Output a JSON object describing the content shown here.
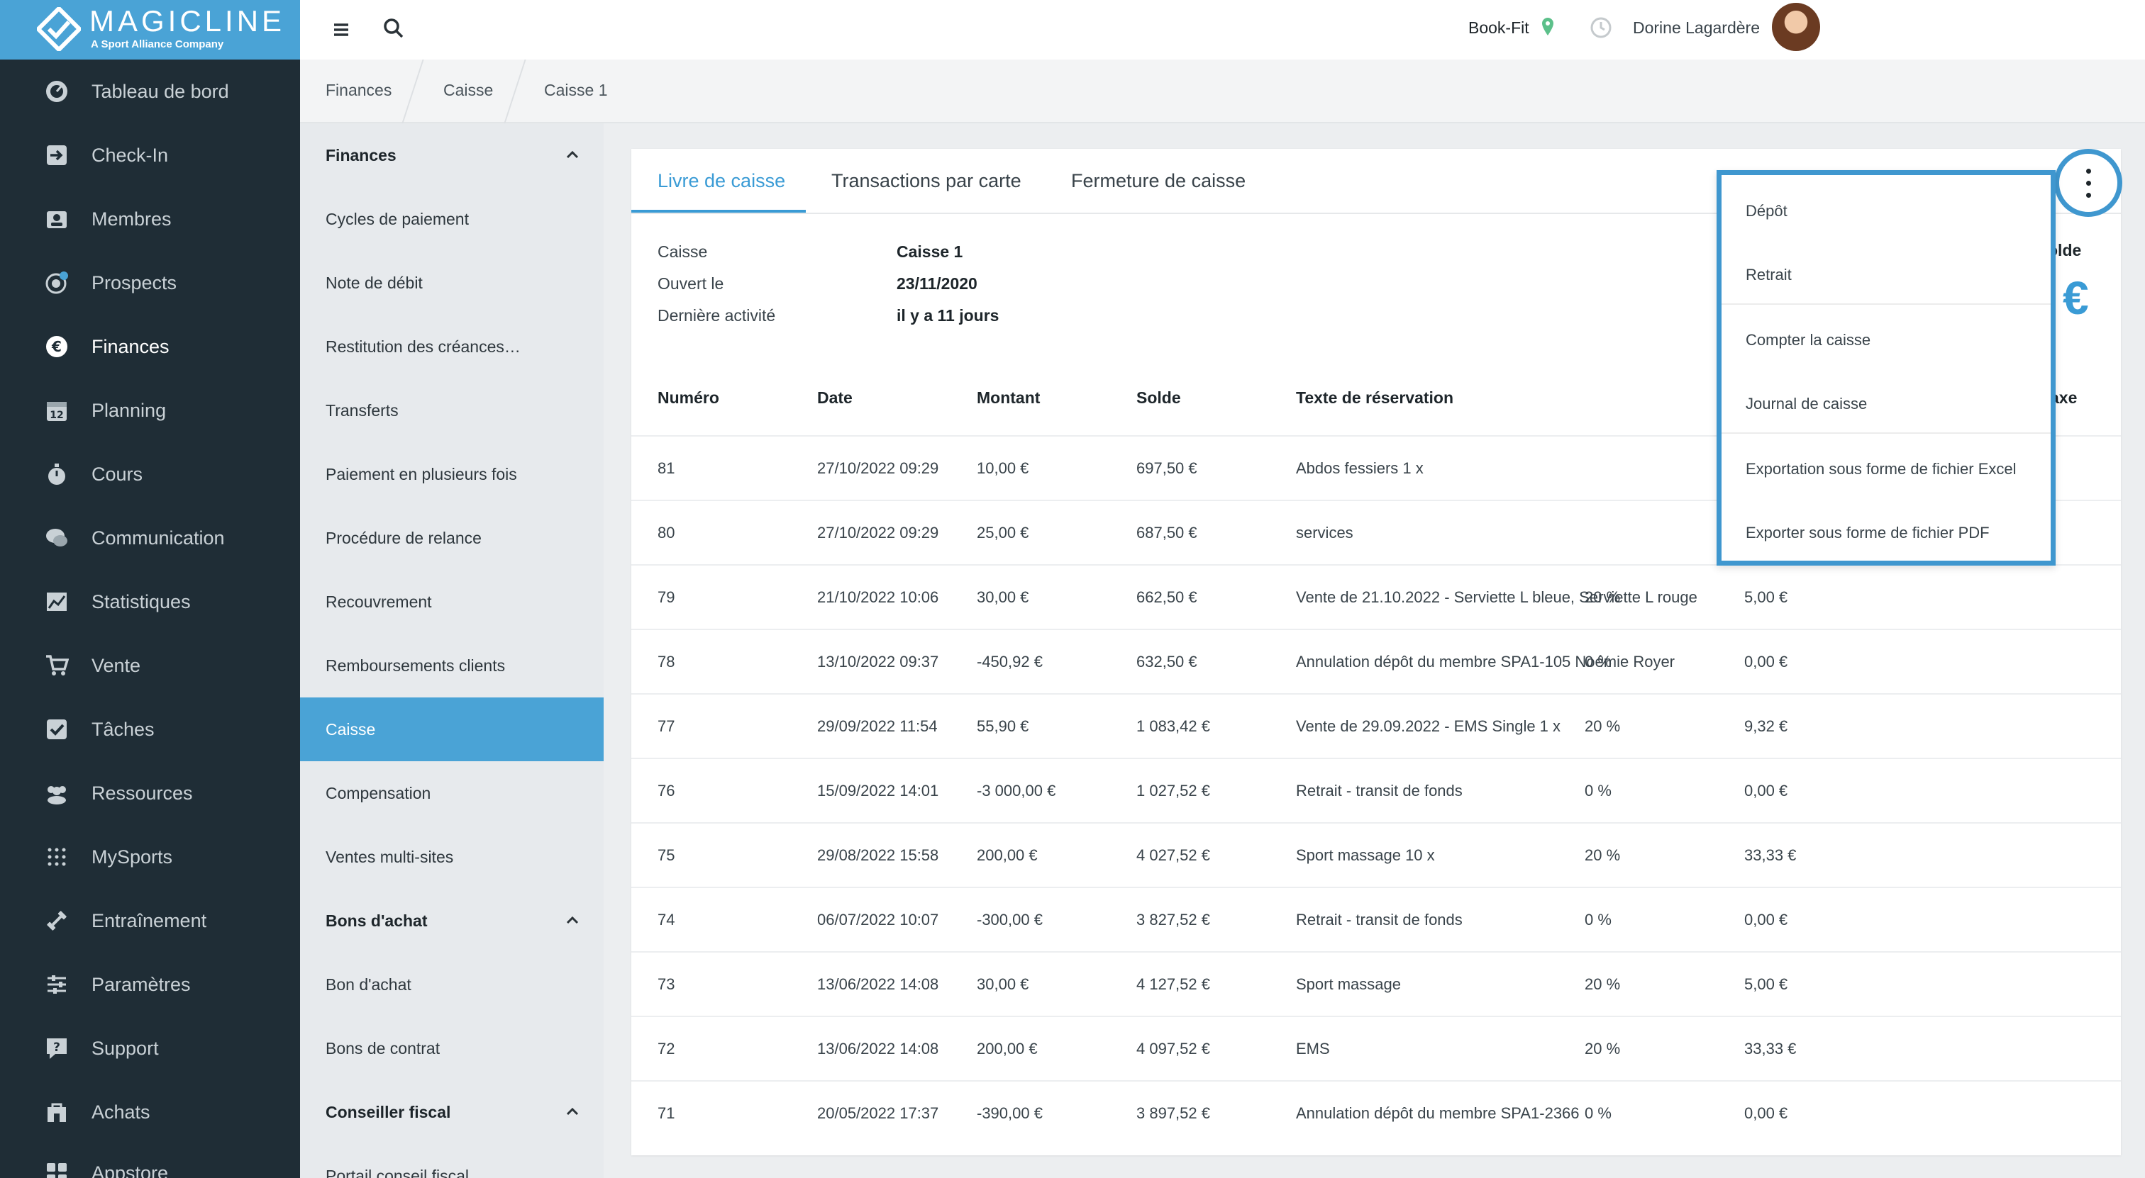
{
  "brand": {
    "name": "MAGICLINE",
    "tagline": "A Sport Alliance Company"
  },
  "sidebar": {
    "items": [
      {
        "label": "Tableau de bord",
        "icon": "dashboard-icon"
      },
      {
        "label": "Check-In",
        "icon": "checkin-icon"
      },
      {
        "label": "Membres",
        "icon": "members-icon"
      },
      {
        "label": "Prospects",
        "icon": "prospects-icon"
      },
      {
        "label": "Finances",
        "icon": "euro-icon",
        "active": true
      },
      {
        "label": "Planning",
        "icon": "calendar-icon"
      },
      {
        "label": "Cours",
        "icon": "stopwatch-icon"
      },
      {
        "label": "Communication",
        "icon": "chat-icon"
      },
      {
        "label": "Statistiques",
        "icon": "chart-icon"
      },
      {
        "label": "Vente",
        "icon": "cart-icon"
      },
      {
        "label": "Tâches",
        "icon": "checkbox-icon"
      },
      {
        "label": "Ressources",
        "icon": "group-icon"
      },
      {
        "label": "MySports",
        "icon": "grid-dots-icon"
      },
      {
        "label": "Entraînement",
        "icon": "dumbbell-icon"
      },
      {
        "label": "Paramètres",
        "icon": "sliders-icon"
      },
      {
        "label": "Support",
        "icon": "help-icon"
      },
      {
        "label": "Achats",
        "icon": "shop-icon"
      },
      {
        "label": "Appstore",
        "icon": "apps-icon"
      }
    ]
  },
  "header": {
    "club": "Book-Fit",
    "user": "Dorine Lagardère"
  },
  "breadcrumb": [
    "Finances",
    "Caisse",
    "Caisse 1"
  ],
  "submenu": {
    "items": [
      {
        "label": "Finances",
        "header": true
      },
      {
        "label": "Cycles de paiement"
      },
      {
        "label": "Note de débit"
      },
      {
        "label": "Restitution des créances…"
      },
      {
        "label": "Transferts"
      },
      {
        "label": "Paiement en plusieurs fois"
      },
      {
        "label": "Procédure de relance"
      },
      {
        "label": "Recouvrement"
      },
      {
        "label": "Remboursements clients"
      },
      {
        "label": "Caisse",
        "selected": true
      },
      {
        "label": "Compensation"
      },
      {
        "label": "Ventes multi-sites"
      },
      {
        "label": "Bons d'achat",
        "header": true
      },
      {
        "label": "Bon d'achat"
      },
      {
        "label": "Bons de contrat"
      },
      {
        "label": "Conseiller fiscal",
        "header": true
      },
      {
        "label": "Portail conseil fiscal"
      }
    ]
  },
  "tabs": [
    "Livre de caisse",
    "Transactions par carte",
    "Fermeture de caisse"
  ],
  "info": {
    "caisse_label": "Caisse",
    "caisse_value": "Caisse 1",
    "opened_label": "Ouvert le",
    "opened_value": "23/11/2020",
    "activity_label": "Dernière activité",
    "activity_value": "il y a 11 jours",
    "solde_fragment": "olde",
    "euro_symbol": "€"
  },
  "table": {
    "headers": [
      "Numéro",
      "Date",
      "Montant",
      "Solde",
      "Texte de réservation"
    ],
    "taxe_fragment": "axe",
    "rows": [
      [
        "81",
        "27/10/2022 09:29",
        "10,00 €",
        "697,50 €",
        "Abdos fessiers 1 x",
        "",
        ""
      ],
      [
        "80",
        "27/10/2022 09:29",
        "25,00 €",
        "687,50 €",
        "services",
        "",
        ""
      ],
      [
        "79",
        "21/10/2022 10:06",
        "30,00 €",
        "662,50 €",
        "Vente de 21.10.2022 - Serviette L bleue, Serviette L rouge",
        "20 %",
        "5,00 €"
      ],
      [
        "78",
        "13/10/2022 09:37",
        "-450,92 €",
        "632,50 €",
        "Annulation dépôt du membre SPA1-105 Noémie Royer",
        "0 %",
        "0,00 €"
      ],
      [
        "77",
        "29/09/2022 11:54",
        "55,90 €",
        "1 083,42 €",
        "Vente de 29.09.2022 - EMS Single 1 x",
        "20 %",
        "9,32 €"
      ],
      [
        "76",
        "15/09/2022 14:01",
        "-3 000,00 €",
        "1 027,52 €",
        "Retrait - transit de fonds",
        "0 %",
        "0,00 €"
      ],
      [
        "75",
        "29/08/2022 15:58",
        "200,00 €",
        "4 027,52 €",
        "Sport massage 10 x",
        "20 %",
        "33,33 €"
      ],
      [
        "74",
        "06/07/2022 10:07",
        "-300,00 €",
        "3 827,52 €",
        "Retrait - transit de fonds",
        "0 %",
        "0,00 €"
      ],
      [
        "73",
        "13/06/2022 14:08",
        "30,00 €",
        "4 127,52 €",
        "Sport massage",
        "20 %",
        "5,00 €"
      ],
      [
        "72",
        "13/06/2022 14:08",
        "200,00 €",
        "4 097,52 €",
        "EMS",
        "20 %",
        "33,33 €"
      ],
      [
        "71",
        "20/05/2022 17:37",
        "-390,00 €",
        "3 897,52 €",
        "Annulation dépôt du membre SPA1-2366",
        "0 %",
        "0,00 €"
      ]
    ]
  },
  "dropdown": {
    "items": [
      "Dépôt",
      "Retrait",
      "Compter la caisse",
      "Journal de caisse",
      "Exportation sous forme de fichier Excel",
      "Exporter sous forme de fichier PDF"
    ]
  },
  "colors": {
    "accent": "#3a9bd5",
    "sidebar_bg": "#1f2d36",
    "logo_bg": "#4aa3d6",
    "highlight": "#3f97cf"
  }
}
